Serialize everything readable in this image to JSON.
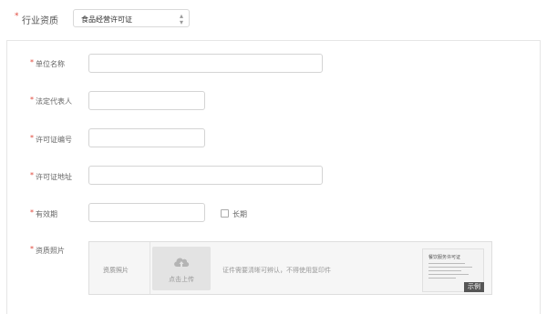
{
  "industry": {
    "label": "行业资质",
    "selected": "食品经营许可证"
  },
  "form": {
    "unit_name": {
      "label": "单位名称",
      "value": ""
    },
    "legal_rep": {
      "label": "法定代表人",
      "value": ""
    },
    "license_no": {
      "label": "许可证编号",
      "value": ""
    },
    "license_address": {
      "label": "许可证地址",
      "value": ""
    },
    "validity": {
      "label": "有效期",
      "value": "",
      "long_term_label": "长期",
      "long_term_checked": false
    },
    "photo": {
      "label": "资质照片",
      "cell_label": "资质照片",
      "upload_label": "点击上传",
      "hint": "证件需要清晰可辨认，不得使用复印件",
      "sample_doc_title": "餐饮服务许可证",
      "sample_tag": "示例"
    }
  },
  "required_mark": "*",
  "colors": {
    "required": "#e0483b",
    "border": "#d4d4d4",
    "sample_tag": "#555555"
  },
  "icons": {
    "upload": "cloud-upload-icon",
    "dropdown": "chevron-updown-icon"
  }
}
